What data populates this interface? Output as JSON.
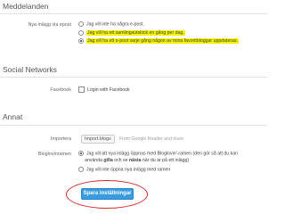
{
  "messages": {
    "title": "Meddelanden",
    "row_label": "Nya inlägg via epost",
    "options": [
      {
        "label": "Jag vill inte ha några e-post.",
        "selected": false,
        "highlighted": false
      },
      {
        "label": "Jag vill ha ett samlingsutskick en gång per dag.",
        "selected": false,
        "highlighted": true
      },
      {
        "label": "Jag vill ha ett e-post varje gång någon av mina favoritbloggar uppdateras.",
        "selected": true,
        "highlighted": true
      }
    ]
  },
  "social": {
    "title": "Social Networks",
    "row_label": "Facebook",
    "checkbox_label": "Login with Facebook",
    "checked": false
  },
  "other": {
    "title": "Annat",
    "import_label": "Importera",
    "import_button": "Import.blogs",
    "import_note": "From Google Reader and more",
    "frame_label": "Bloglovinramen",
    "frame_option_1_line_1": "Jag vill att nya inlägg öppnas med Bloglovin'-ramen (den gör så att du kan",
    "frame_option_1_line_2_a": "använda ",
    "frame_option_1_line_2_b": "gilla",
    "frame_option_1_line_2_c": " och se ",
    "frame_option_1_line_2_d": "nästa",
    "frame_option_1_line_2_e": " när du är på ett inlägg)",
    "frame_option_2": "Jag vill inte öppna nya inlägg med ramen",
    "frame_selected": 0
  },
  "save_button": "Spara inställningar",
  "colors": {
    "highlight": "#f4f200",
    "save_button": "#3a9be0",
    "annotation_circle": "#d42a2a"
  }
}
